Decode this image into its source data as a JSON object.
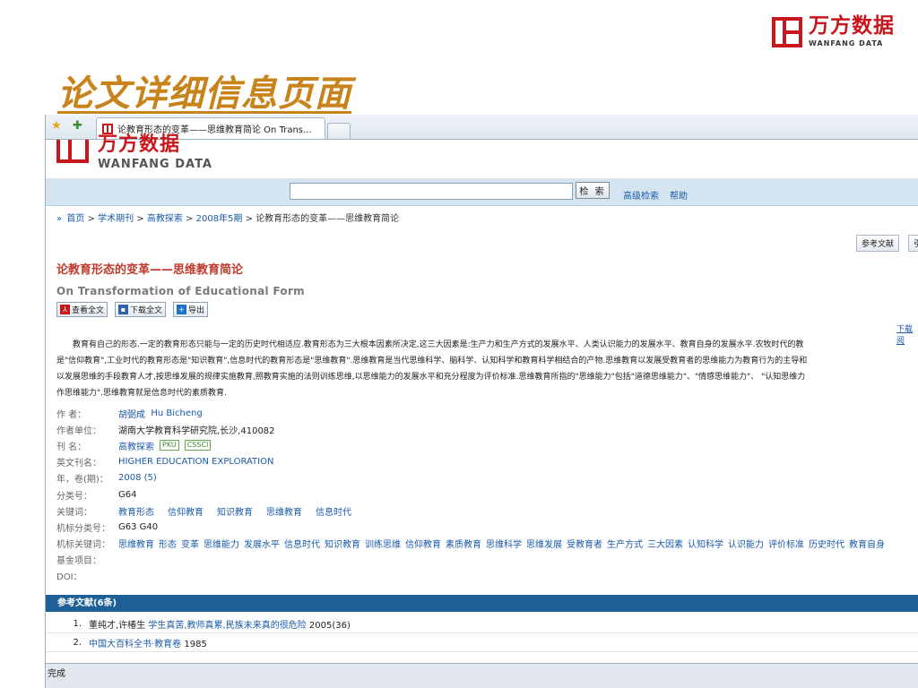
{
  "slide": {
    "title": "论文详细信息页面",
    "logo_cn": "万方数据",
    "logo_en": "WANFANG DATA"
  },
  "browser": {
    "tab_title": "论教育形态的变革——思维教育简论 On Trans...",
    "status_text": "完成"
  },
  "site": {
    "logo_cn": "万方数据",
    "logo_en": "WANFANG DATA",
    "search_placeholder": "",
    "search_button": "检 索",
    "advanced_search": "高级检索",
    "help": "帮助"
  },
  "breadcrumb": {
    "home": "首页",
    "journals": "学术期刊",
    "journal": "高教探索",
    "issue": "2008年5期",
    "current": "论教育形态的变革——思维教育简论",
    "sep": ">"
  },
  "buttons": {
    "references": "参考文献",
    "second": "引",
    "view_full": "查看全文",
    "download_full": "下载全文",
    "export": "导出",
    "download_link": "下载阅"
  },
  "article": {
    "title": "论教育形态的变革——思维教育简论",
    "title_en": "On Transformation of Educational Form",
    "abstract_lines": [
      "　　教育有自己的形态.一定的教育形态只能与一定的历史时代相适应.教育形态为三大根本因素所决定,这三大因素是:生产力和生产方式的发展水平、人类认识能力的发展水平、教育自身的发展水平.农牧时代的教",
      "是\"信仰教育\",工业时代的教育形态是\"知识教育\",信息时代的教育形态是\"思维教育\".思维教育是当代思维科学、脑科学、认知科学和教育科学相结合的产物.思维教育以发展受教育者的思维能力为教育行为的主导和",
      "以发展思维的手段教育人才,按思维发展的规律实施教育,照教育实施的法则训练思维,以思维能力的发展水平和充分程度为评价标准.思维教育所指的\"思维能力\"包括\"道德思维能力\"、\"情感思维能力\"、 \"认知思维力",
      "作思维能力\".思维教育就是信息时代的素质教育."
    ]
  },
  "meta": {
    "author_label": "作 者：",
    "author": "胡弼成",
    "author_en": "Hu Bicheng",
    "org_label": "作者单位：",
    "org": "湖南大学教育科学研究院,长沙,410082",
    "journal_label": "刊 名：",
    "journal": "高教探索",
    "badge1": "PKU",
    "badge2": "CSSCI",
    "journal_en_label": "英文刊名：",
    "journal_en": "HIGHER EDUCATION EXPLORATION",
    "year_label": "年，卷(期)：",
    "year": "2008 (5)",
    "class_label": "分类号：",
    "class": "G64",
    "keywords_label": "关键词：",
    "keywords": [
      "教育形态",
      "信仰教育",
      "知识教育",
      "思维教育",
      "信息时代"
    ],
    "machine_class_label": "机标分类号：",
    "machine_class": "G63 G40",
    "machine_keywords_label": "机标关键词：",
    "machine_keywords": [
      "思维教育",
      "形态",
      "变革",
      "思维能力",
      "发展水平",
      "信息时代",
      "知识教育",
      "训练思维",
      "信仰教育",
      "素质教育",
      "思维科学",
      "思维发展",
      "受教育者",
      "生产方式",
      "三大因素",
      "认知科学",
      "认识能力",
      "评价标准",
      "历史时代",
      "教育自身"
    ],
    "fund_label": "基金项目：",
    "doi_label": "DOI："
  },
  "references": {
    "header": "参考文献(6条)",
    "items": [
      {
        "num": "1.",
        "authors": "董纯才,许椿生",
        "link": "学生真苦,教师真累,民族未来真的很危险",
        "tail": "2005(36)"
      },
      {
        "num": "2.",
        "authors": "",
        "link": "中国大百科全书·教育卷",
        "tail": "1985"
      }
    ]
  }
}
